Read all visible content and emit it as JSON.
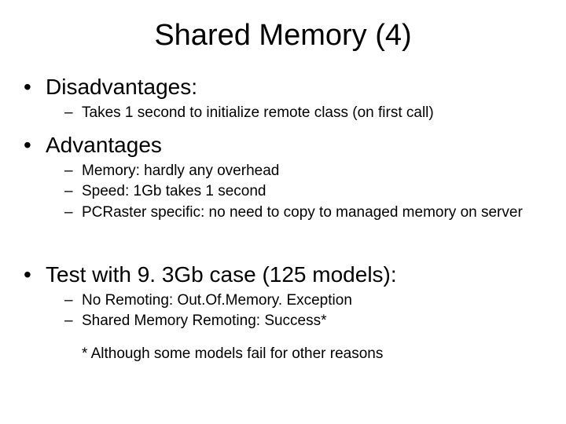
{
  "title": "Shared Memory (4)",
  "sections": [
    {
      "heading": "Disadvantages:",
      "items": [
        "Takes 1 second to initialize remote class (on first call)"
      ]
    },
    {
      "heading": "Advantages",
      "items": [
        "Memory: hardly any overhead",
        "Speed: 1Gb takes 1 second",
        "PCRaster specific: no need to copy to managed memory on server"
      ]
    },
    {
      "heading": "Test with 9. 3Gb case (125 models):",
      "items": [
        "No Remoting: Out.Of.Memory. Exception",
        "Shared Memory Remoting: Success*"
      ]
    }
  ],
  "footnote": "* Although some models fail for other reasons"
}
